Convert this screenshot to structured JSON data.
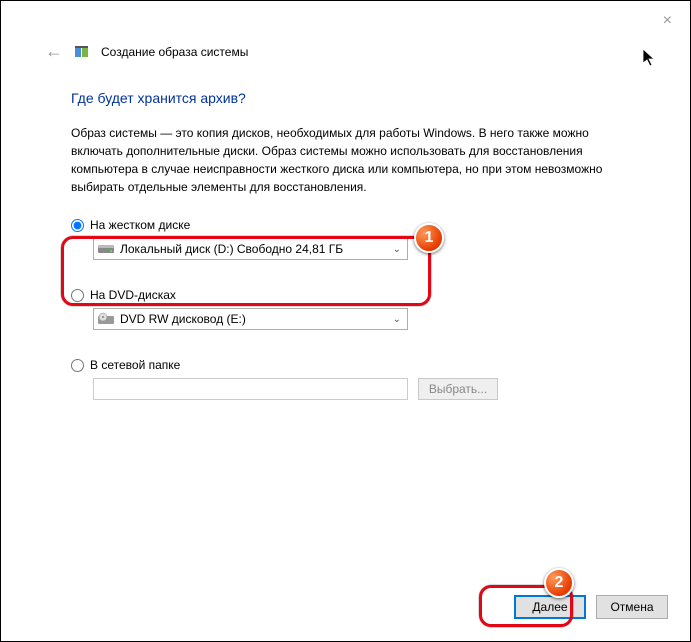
{
  "window": {
    "close": "×"
  },
  "header": {
    "back": "←",
    "title": "Создание образа системы"
  },
  "heading": "Где будет хранится архив?",
  "description": "Образ системы — это копия дисков, необходимых для работы Windows. В него также можно включать дополнительные диски. Образ системы можно использовать для восстановления компьютера в случае неисправности жесткого диска или компьютера, но при этом невозможно выбирать отдельные элементы для восстановления.",
  "options": {
    "hdd": {
      "label": "На жестком диске",
      "selected": "Локальный диск (D:)  Свободно 24,81 ГБ"
    },
    "dvd": {
      "label": "На DVD-дисках",
      "selected": "DVD RW дисковод (E:)"
    },
    "network": {
      "label": "В сетевой папке",
      "input": "",
      "browse": "Выбрать..."
    }
  },
  "buttons": {
    "next": "Далее",
    "cancel": "Отмена"
  },
  "badges": {
    "one": "1",
    "two": "2"
  }
}
